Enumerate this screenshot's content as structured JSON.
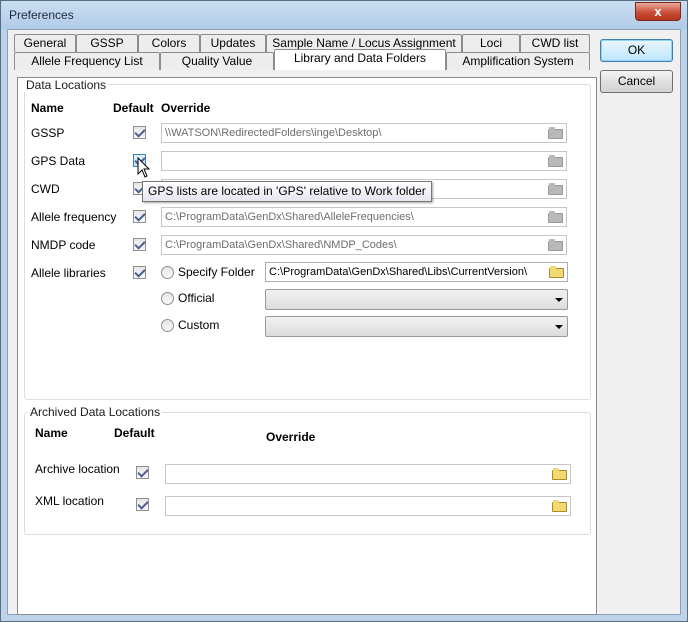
{
  "window": {
    "title": "Preferences",
    "close_label": "x"
  },
  "tabs_row1": [
    "General",
    "GSSP",
    "Colors",
    "Updates",
    "Sample Name / Locus Assignment",
    "Loci",
    "CWD list"
  ],
  "tabs_row2": [
    "Allele Frequency List",
    "Quality Value",
    "Library and Data Folders",
    "Amplification System"
  ],
  "active_tab": "Library and Data Folders",
  "data_locations": {
    "title": "Data Locations",
    "headers": {
      "name": "Name",
      "default": "Default",
      "override": "Override"
    },
    "rows": [
      {
        "name": "GSSP",
        "default": true,
        "value": "\\\\WATSON\\RedirectedFolders\\inge\\Desktop\\"
      },
      {
        "name": "GPS Data",
        "default": true,
        "value": ""
      },
      {
        "name": "CWD",
        "default": true,
        "value": ""
      },
      {
        "name": "Allele frequency",
        "default": true,
        "value": "C:\\ProgramData\\GenDx\\Shared\\AlleleFrequencies\\"
      },
      {
        "name": "NMDP code",
        "default": true,
        "value": "C:\\ProgramData\\GenDx\\Shared\\NMDP_Codes\\"
      }
    ],
    "allele_libraries": {
      "name": "Allele libraries",
      "default": true,
      "options": [
        "Specify Folder",
        "Official",
        "Custom"
      ],
      "folder_value": "C:\\ProgramData\\GenDx\\Shared\\Libs\\CurrentVersion\\",
      "official_value": "",
      "custom_value": ""
    }
  },
  "archived": {
    "title": "Archived Data Locations",
    "headers": {
      "name": "Name",
      "default": "Default",
      "override": "Override"
    },
    "rows": [
      {
        "name": "Archive location",
        "default": true,
        "value": ""
      },
      {
        "name": "XML location",
        "default": true,
        "value": ""
      }
    ]
  },
  "buttons": {
    "ok": "OK",
    "cancel": "Cancel"
  },
  "tooltip": "GPS lists are located in 'GPS' relative to Work folder",
  "icons": {
    "folder_disabled": "folder-icon",
    "folder_enabled": "folder-icon",
    "cursor": "mouse-pointer-icon"
  },
  "colors": {
    "titlebar": "#bcd3ea",
    "close": "#c9503a",
    "folder": "#f3d971"
  }
}
